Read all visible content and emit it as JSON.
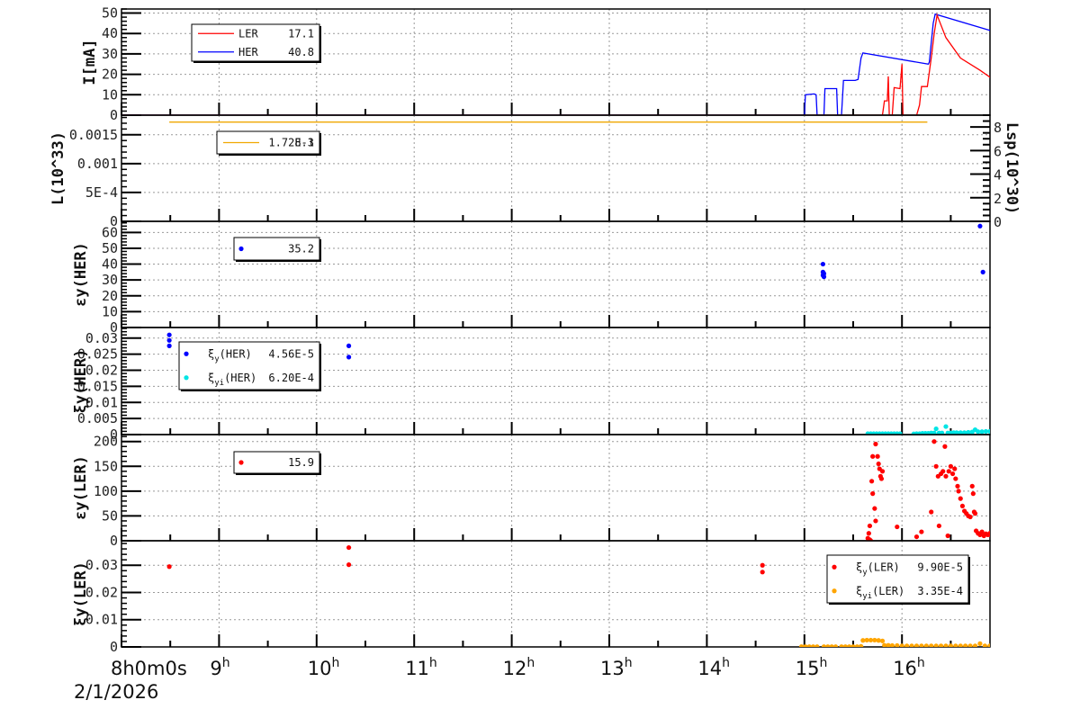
{
  "colors": {
    "ler": "#ff0000",
    "her": "#0000ff",
    "lum": "#f0a800",
    "her_xi_i": "#00e5e5",
    "ler_xi_i": "#ffa500"
  },
  "x_axis": {
    "start_label": "8h0m0s",
    "date": "2/1/2026",
    "hours": [
      8,
      9,
      10,
      11,
      12,
      13,
      14,
      15,
      16
    ],
    "hour_suffix": "h",
    "range": [
      8,
      16.95
    ]
  },
  "chart_data": [
    {
      "type": "line",
      "ylabel": "I[mA]",
      "ylim": [
        0,
        52
      ],
      "yticks": [
        "0",
        "10",
        "20",
        "30",
        "40",
        "50"
      ],
      "ytick_values": [
        0,
        10,
        20,
        30,
        40,
        50
      ],
      "legend": [
        {
          "name": "LER",
          "value": "17.1",
          "color": "#ff0000"
        },
        {
          "name": "HER",
          "value": "40.8",
          "color": "#0000ff"
        }
      ],
      "series": [
        {
          "name": "HER",
          "color": "#0000ff",
          "points": [
            [
              8,
              0
            ],
            [
              15,
              0
            ],
            [
              15.01,
              10
            ],
            [
              15.1,
              10.4
            ],
            [
              15.12,
              10
            ],
            [
              15.13,
              0
            ],
            [
              15.2,
              0
            ],
            [
              15.21,
              13
            ],
            [
              15.33,
              13
            ],
            [
              15.34,
              0
            ],
            [
              15.38,
              0
            ],
            [
              15.4,
              17
            ],
            [
              15.52,
              17
            ],
            [
              15.55,
              17.5
            ],
            [
              15.58,
              28
            ],
            [
              15.6,
              30.5
            ],
            [
              16.27,
              25
            ],
            [
              16.28,
              26
            ],
            [
              16.32,
              45
            ],
            [
              16.34,
              49.5
            ],
            [
              16.95,
              40.8
            ]
          ]
        },
        {
          "name": "LER",
          "color": "#ff0000",
          "points": [
            [
              8,
              0
            ],
            [
              15.8,
              0
            ],
            [
              15.82,
              7
            ],
            [
              15.85,
              7
            ],
            [
              15.86,
              19
            ],
            [
              15.87,
              0
            ],
            [
              15.9,
              0
            ],
            [
              15.92,
              13.5
            ],
            [
              15.98,
              13
            ],
            [
              16,
              25
            ],
            [
              16.01,
              0
            ],
            [
              16.15,
              0
            ],
            [
              16.18,
              5
            ],
            [
              16.2,
              14
            ],
            [
              16.26,
              14
            ],
            [
              16.3,
              28
            ],
            [
              16.33,
              40
            ],
            [
              16.36,
              49
            ],
            [
              16.45,
              38
            ],
            [
              16.6,
              28
            ],
            [
              16.8,
              22
            ],
            [
              16.95,
              17
            ]
          ]
        }
      ]
    },
    {
      "type": "line",
      "ylabel": "L(10^33)",
      "ylim": [
        0,
        0.00184
      ],
      "yticks": [
        "0",
        "5E-4",
        "0.001",
        "0.0015"
      ],
      "ytick_values": [
        0,
        0.0005,
        0.001,
        0.0015
      ],
      "right_axis": {
        "label": "Lsp(10^30)",
        "ylim": [
          0,
          9
        ],
        "yticks": [
          "0",
          "2",
          "4",
          "6",
          "8"
        ],
        "ytick_values": [
          0,
          2,
          4,
          6,
          8
        ]
      },
      "legend": [
        {
          "name": "",
          "value": "1.72E-3",
          "overlap": "8.1",
          "color": "#f0a800"
        }
      ],
      "series": [
        {
          "name": "L",
          "color": "#f0a800",
          "points": [
            [
              8.49,
              0.00172
            ],
            [
              16.26,
              0.00172
            ]
          ]
        }
      ]
    },
    {
      "type": "scatter",
      "ylabel": "εy(HER)",
      "ylim": [
        0,
        67
      ],
      "yticks": [
        "0",
        "10",
        "20",
        "30",
        "40",
        "50",
        "60"
      ],
      "ytick_values": [
        0,
        10,
        20,
        30,
        40,
        50,
        60
      ],
      "legend": [
        {
          "name": "",
          "value": "35.2",
          "color": "#0000ff"
        }
      ],
      "series": [
        {
          "name": "εy(HER)",
          "color": "#0000ff",
          "points": [
            [
              15.19,
              40
            ],
            [
              15.19,
              35
            ],
            [
              15.2,
              34
            ],
            [
              15.19,
              33
            ],
            [
              15.2,
              32
            ],
            [
              16.8,
              64
            ],
            [
              16.83,
              35
            ]
          ]
        }
      ]
    },
    {
      "type": "scatter",
      "ylabel": "ξy(HER)",
      "ylim": [
        0,
        0.0333
      ],
      "yticks": [
        "0",
        "0.005",
        "0.01",
        "0.015",
        "0.02",
        "0.025",
        "0.03"
      ],
      "ytick_values": [
        0,
        0.005,
        0.01,
        0.015,
        0.02,
        0.025,
        0.03
      ],
      "legend": [
        {
          "name": "ξy(HER)",
          "value": "4.56E-5",
          "color": "#0000ff"
        },
        {
          "name": "ξyi(HER)",
          "value": "6.20E-4",
          "color": "#00e5e5"
        }
      ],
      "series": [
        {
          "name": "ξy(HER)",
          "color": "#0000ff",
          "points": [
            [
              8.49,
              0.031
            ],
            [
              8.49,
              0.0293
            ],
            [
              8.49,
              0.0276
            ],
            [
              10.33,
              0.0276
            ],
            [
              10.33,
              0.0241
            ]
          ]
        },
        {
          "name": "ξyi(HER)",
          "color": "#00e5e5",
          "points": [
            [
              15.65,
              0.0003
            ],
            [
              15.68,
              0.0003
            ],
            [
              15.71,
              0.0003
            ],
            [
              15.74,
              0.0003
            ],
            [
              15.77,
              0.0003
            ],
            [
              15.8,
              0.0003
            ],
            [
              15.83,
              0.0003
            ],
            [
              15.86,
              0.0003
            ],
            [
              15.89,
              0.0003
            ],
            [
              15.92,
              0.0003
            ],
            [
              15.95,
              0.0003
            ],
            [
              15.98,
              0.0003
            ],
            [
              16.12,
              0.0002
            ],
            [
              16.15,
              0.0003
            ],
            [
              16.18,
              0.0003
            ],
            [
              16.21,
              0.0004
            ],
            [
              16.24,
              0.0004
            ],
            [
              16.27,
              0.0004
            ],
            [
              16.3,
              0.0005
            ],
            [
              16.33,
              0.0005
            ],
            [
              16.35,
              0.0018
            ],
            [
              16.38,
              0.0005
            ],
            [
              16.41,
              0.0005
            ],
            [
              16.45,
              0.0025
            ],
            [
              16.47,
              0.0005
            ],
            [
              16.5,
              0.0005
            ],
            [
              16.53,
              0.0006
            ],
            [
              16.56,
              0.0006
            ],
            [
              16.6,
              0.0006
            ],
            [
              16.64,
              0.0006
            ],
            [
              16.68,
              0.0007
            ],
            [
              16.72,
              0.0008
            ],
            [
              16.75,
              0.0015
            ],
            [
              16.78,
              0.0009
            ],
            [
              16.82,
              0.0009
            ],
            [
              16.86,
              0.001
            ],
            [
              16.9,
              0.001
            ],
            [
              16.94,
              0.001
            ]
          ]
        }
      ]
    },
    {
      "type": "scatter",
      "ylabel": "εy(LER)",
      "ylim": [
        0,
        214
      ],
      "yticks": [
        "0",
        "50",
        "100",
        "150",
        "200"
      ],
      "ytick_values": [
        0,
        50,
        100,
        150,
        200
      ],
      "legend": [
        {
          "name": "",
          "value": "15.9",
          "color": "#ff0000"
        }
      ],
      "series": [
        {
          "name": "εy(LER)",
          "color": "#ff0000",
          "points": [
            [
              15.65,
              5
            ],
            [
              15.66,
              15
            ],
            [
              15.67,
              30
            ],
            [
              15.67,
              2
            ],
            [
              15.68,
              0
            ],
            [
              15.69,
              120
            ],
            [
              15.7,
              95
            ],
            [
              15.7,
              170
            ],
            [
              15.72,
              65
            ],
            [
              15.73,
              40
            ],
            [
              15.73,
              195
            ],
            [
              15.75,
              170
            ],
            [
              15.76,
              155
            ],
            [
              15.77,
              145
            ],
            [
              15.78,
              130
            ],
            [
              15.79,
              125
            ],
            [
              15.8,
              140
            ],
            [
              15.95,
              28
            ],
            [
              16.15,
              8
            ],
            [
              16.2,
              18
            ],
            [
              16.3,
              58
            ],
            [
              16.33,
              200
            ],
            [
              16.35,
              150
            ],
            [
              16.37,
              130
            ],
            [
              16.38,
              30
            ],
            [
              16.4,
              135
            ],
            [
              16.42,
              140
            ],
            [
              16.44,
              190
            ],
            [
              16.45,
              130
            ],
            [
              16.47,
              10
            ],
            [
              16.48,
              140
            ],
            [
              16.5,
              150
            ],
            [
              16.52,
              135
            ],
            [
              16.54,
              145
            ],
            [
              16.55,
              125
            ],
            [
              16.57,
              110
            ],
            [
              16.58,
              100
            ],
            [
              16.6,
              85
            ],
            [
              16.62,
              70
            ],
            [
              16.64,
              60
            ],
            [
              16.66,
              55
            ],
            [
              16.68,
              50
            ],
            [
              16.7,
              48
            ],
            [
              16.72,
              110
            ],
            [
              16.73,
              95
            ],
            [
              16.74,
              58
            ],
            [
              16.75,
              55
            ],
            [
              16.76,
              20
            ],
            [
              16.78,
              15
            ],
            [
              16.8,
              12
            ],
            [
              16.82,
              18
            ],
            [
              16.84,
              10
            ],
            [
              16.86,
              14
            ],
            [
              16.88,
              12
            ],
            [
              16.9,
              15
            ],
            [
              16.92,
              10
            ],
            [
              16.95,
              13
            ]
          ]
        }
      ]
    },
    {
      "type": "scatter",
      "ylabel": "ξy(LER)",
      "ylim": [
        0,
        0.039
      ],
      "yticks": [
        "0",
        "0.01",
        "0.02",
        "0.03"
      ],
      "ytick_values": [
        0,
        0.01,
        0.02,
        0.03
      ],
      "legend": [
        {
          "name": "ξy(LER)",
          "value": "9.90E-5",
          "color": "#ff0000"
        },
        {
          "name": "ξyi(LER)",
          "value": "3.35E-4",
          "color": "#ffa500"
        }
      ],
      "series": [
        {
          "name": "ξy(LER)",
          "color": "#ff0000",
          "points": [
            [
              8.49,
              0.0295
            ],
            [
              10.33,
              0.0365
            ],
            [
              10.33,
              0.0302
            ],
            [
              14.57,
              0.03
            ],
            [
              14.57,
              0.0275
            ]
          ]
        },
        {
          "name": "ξyi(LER)",
          "color": "#ffa500",
          "points": [
            [
              14.97,
              0.0001
            ],
            [
              15.01,
              0.0001
            ],
            [
              15.05,
              0.0001
            ],
            [
              15.09,
              0.0001
            ],
            [
              15.13,
              0.0001
            ],
            [
              15.2,
              0.0001
            ],
            [
              15.24,
              0.0001
            ],
            [
              15.28,
              0.0001
            ],
            [
              15.32,
              0.0001
            ],
            [
              15.38,
              0.0001
            ],
            [
              15.42,
              0.0001
            ],
            [
              15.46,
              0.0001
            ],
            [
              15.5,
              0.0001
            ],
            [
              15.54,
              0.0001
            ],
            [
              15.58,
              0.0002
            ],
            [
              15.6,
              0.0024
            ],
            [
              15.64,
              0.0025
            ],
            [
              15.68,
              0.0025
            ],
            [
              15.72,
              0.0025
            ],
            [
              15.76,
              0.0024
            ],
            [
              15.8,
              0.0022
            ],
            [
              15.82,
              0.0006
            ],
            [
              15.86,
              0.0006
            ],
            [
              15.9,
              0.0005
            ],
            [
              15.95,
              0.0005
            ],
            [
              16,
              0.0004
            ],
            [
              16.05,
              0.0004
            ],
            [
              16.1,
              0.0004
            ],
            [
              16.15,
              0.0004
            ],
            [
              16.2,
              0.0004
            ],
            [
              16.25,
              0.0004
            ],
            [
              16.3,
              0.0004
            ],
            [
              16.35,
              0.0004
            ],
            [
              16.4,
              0.0004
            ],
            [
              16.45,
              0.0004
            ],
            [
              16.5,
              0.0004
            ],
            [
              16.55,
              0.0004
            ],
            [
              16.6,
              0.0004
            ],
            [
              16.65,
              0.0004
            ],
            [
              16.7,
              0.0004
            ],
            [
              16.75,
              0.0004
            ],
            [
              16.8,
              0.0012
            ],
            [
              16.85,
              0.0004
            ],
            [
              16.9,
              0.0004
            ],
            [
              16.95,
              0.0004
            ]
          ]
        }
      ]
    }
  ]
}
